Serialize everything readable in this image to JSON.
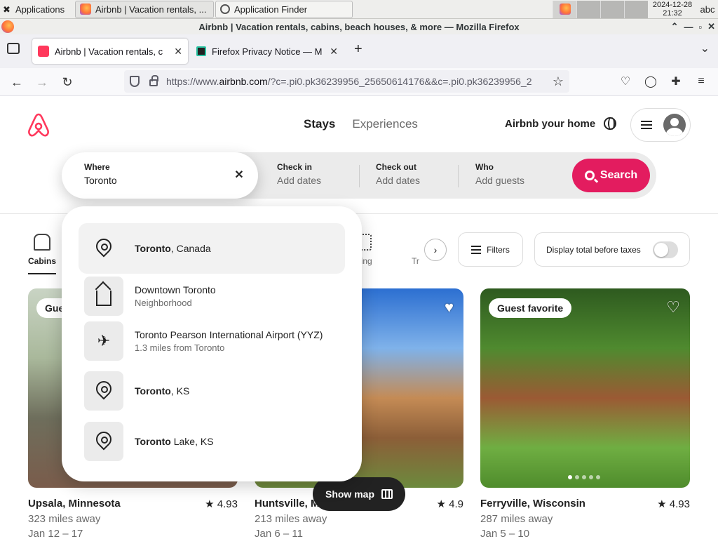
{
  "taskbar": {
    "apps_label": "Applications",
    "task1_label": "Airbnb | Vacation rentals, ...",
    "task2_label": "Application Finder",
    "clock_date": "2024-12-28",
    "clock_time": "21:32",
    "keyboard": "abc"
  },
  "window": {
    "title": "Airbnb | Vacation rentals, cabins, beach houses, & more — Mozilla Firefox"
  },
  "tabs": [
    {
      "label": "Airbnb | Vacation rentals, c"
    },
    {
      "label": "Firefox Privacy Notice — M"
    }
  ],
  "urlbar": {
    "prefix": "https://www.",
    "domain": "airbnb.com",
    "path": "/?c=.pi0.pk36239956_25650614176&&c=.pi0.pk36239956_2"
  },
  "header": {
    "stays": "Stays",
    "experiences": "Experiences",
    "host": "Airbnb your home"
  },
  "search": {
    "where_label": "Where",
    "where_value": "Toronto",
    "checkin_label": "Check in",
    "checkin_placeholder": "Add dates",
    "checkout_label": "Check out",
    "checkout_placeholder": "Add dates",
    "who_label": "Who",
    "who_placeholder": "Add guests",
    "button": "Search"
  },
  "suggestions": [
    {
      "bold": "Toronto",
      "rest": ", Canada",
      "secondary": "",
      "icon": "pin-icon"
    },
    {
      "bold": "",
      "rest": "Downtown Toronto",
      "secondary": "Neighborhood",
      "icon": "house-icon"
    },
    {
      "bold": "",
      "rest": "Toronto Pearson International Airport (YYZ)",
      "secondary": "1.3 miles from Toronto",
      "icon": "plane-icon"
    },
    {
      "bold": "Toronto",
      "rest": ", KS",
      "secondary": "",
      "icon": "pin-icon"
    },
    {
      "bold": "Toronto",
      "rest": " Lake, KS",
      "secondary": "",
      "icon": "pin-icon"
    }
  ],
  "categories": {
    "first": "Cabins",
    "partial": "kiing",
    "partial2": "Tr"
  },
  "filters": {
    "label": "Filters",
    "taxes_label": "Display total before taxes"
  },
  "listings": [
    {
      "badge": "Gue",
      "title": "Upsala, Minnesota",
      "rating": "4.93",
      "distance": "323 miles away",
      "dates": "Jan 12 – 17"
    },
    {
      "badge": "",
      "title": "Huntsville, M",
      "rating": "4.9",
      "distance": "213 miles away",
      "dates": "Jan 6 – 11"
    },
    {
      "badge": "Guest favorite",
      "title": "Ferryville, Wisconsin",
      "rating": "4.93",
      "distance": "287 miles away",
      "dates": "Jan 5 – 10"
    }
  ],
  "showmap": "Show map",
  "colors": {
    "brand": "#ff385c",
    "search_button": "#e31c5f"
  }
}
